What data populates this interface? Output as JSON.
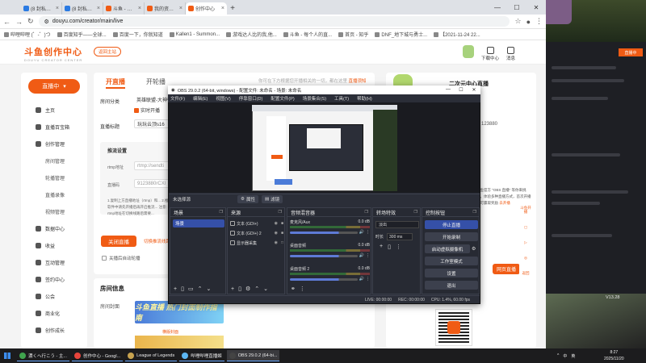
{
  "browser": {
    "tabs": [
      {
        "label": "(8 封私信 / 24 条消息) 斯万 -",
        "color": "#2a7ae2",
        "active": false
      },
      {
        "label": "(8 封私信 / 24 条消息) 如何评",
        "color": "#2a7ae2",
        "active": false
      },
      {
        "label": "斗鱼 - 每个人的直播平台",
        "color": "#f05b14",
        "active": false
      },
      {
        "label": "我的资料 - 个人中心 - 斗鱼",
        "color": "#f05b14",
        "active": false
      },
      {
        "label": "创作中心",
        "color": "#f05b14",
        "active": true
      }
    ],
    "new_tab": "+",
    "url": "douyu.com/creator/main/live",
    "bookmarks": [
      "哔哩哔哩 (゜-゜)つ",
      "百度知乎——全球...",
      "百度一下，你就知道",
      "Kallen1 - Summon...",
      "游戏达人比的我,他...",
      "斗鱼 - 每个人的直...",
      "首页 - 知乎",
      "DNF_地下城与勇士...",
      "【2021-11-24 22..."
    ]
  },
  "douyu": {
    "logo": "斗鱼创作中心",
    "logo_sub": "DOUYU CREATOR CENTER",
    "home_button": "返回主站",
    "download_center": "下载中心",
    "messages": "消息",
    "live_button": "直播中",
    "sidebar": [
      {
        "label": "主页",
        "sub": []
      },
      {
        "label": "直播百宝箱",
        "sub": []
      },
      {
        "label": "创作管理",
        "sub": [
          "房间管理",
          "轮播管理",
          "直播录像",
          "视频管理"
        ]
      },
      {
        "label": "数据中心",
        "sub": []
      },
      {
        "label": "收益",
        "sub": []
      },
      {
        "label": "互动管理",
        "sub": []
      },
      {
        "label": "签约中心",
        "sub": []
      },
      {
        "label": "公会",
        "sub": []
      },
      {
        "label": "商业化",
        "sub": []
      },
      {
        "label": "创作成长",
        "sub": []
      }
    ],
    "tabs": {
      "open": "开直播",
      "mobile": "开轮播"
    },
    "tip": "你可在下方根据您开播相关的一切，都在这里",
    "tip_link": "直播须知",
    "form": {
      "category_label": "房间分类",
      "category_value": "英雄联盟-大神带",
      "checkbox_label": "实时开播",
      "title_label": "直播标题",
      "title_value": "玩玩云顶s16",
      "settings_title": "推流设置",
      "rtmp_label": "rtmp地址",
      "rtmp_value": "rtmp://sendti",
      "code_label": "直播码",
      "code_value": "9123880rCXl",
      "notes": "1.复制上方直播地址（rtmp）和... 2.推流软件中请先开播后再开启推流... 注意：rtmp地址在切换线路后需要...",
      "start_button": "关闭直播",
      "start_link": "切换推流线路",
      "auto_label": "关播后自动轮播"
    },
    "room": {
      "title": "房间信息",
      "cover_label": "房间封面",
      "banner1": "斗鱼直播 热门封面制作指南",
      "banner2_label": "横版封面"
    },
    "right_card": {
      "title": "二次元中心直播",
      "desc": "斗鱼官方 \"OBS 直播\" 等你来挑战，体验多种直播方式，首次开播即可赢取奖励",
      "desc_link": "去开播",
      "code_tail": "123880",
      "web_button": "网页直播"
    },
    "side_float": [
      "斗鱼开播",
      "返回"
    ]
  },
  "obs": {
    "title": "OBS 29.0.2 (64-bit, windows) - 配置文件: 未命名 - 场景: 未命名",
    "menu": [
      "文件(F)",
      "编辑(E)",
      "视图(V)",
      "停靠窗口(D)",
      "配置文件(P)",
      "场景集合(S)",
      "工具(T)",
      "帮助(H)"
    ],
    "no_source": "未选择源",
    "properties": "属性",
    "filters": "滤镜",
    "scenes_title": "场景",
    "scene_item": "场景",
    "sources_title": "来源",
    "sources": [
      {
        "name": "文本 (GDI+)",
        "locked": true
      },
      {
        "name": "文本 (GDI+) 2",
        "locked": true
      },
      {
        "name": "显示器采集",
        "locked": false
      }
    ],
    "mixer_title": "音频混音器",
    "mixer": [
      {
        "name": "麦克风/Aux",
        "db": "0.0 dB",
        "level": 0.72
      },
      {
        "name": "桌面音频",
        "db": "0.0 dB",
        "level": 0.72
      },
      {
        "name": "桌面音频 2",
        "db": "0.0 dB",
        "level": 0.72
      }
    ],
    "transitions_title": "转场特效",
    "transition": "淡出",
    "duration_label": "时长",
    "duration": "300 ms",
    "controls_title": "控制按钮",
    "controls": [
      "停止直播",
      "开始录制",
      "启动虚拟摄像机",
      "工作室模式",
      "设置",
      "退出"
    ],
    "status": {
      "live": "LIVE: 00:00:00",
      "rec": "REC: 00:00:00",
      "cpu": "CPU: 1.4%, 60.00 fps"
    }
  },
  "bg_app": {
    "button": "直播中",
    "version": "V13.28"
  },
  "taskbar": {
    "items": [
      {
        "label": "濃くへ行こう - 主...",
        "color": "#3fa34d",
        "active": false
      },
      {
        "label": "创作中心 - Googl...",
        "color": "#e8453c",
        "active": false
      },
      {
        "label": "League of Legends",
        "color": "#c8a34f",
        "active": false
      },
      {
        "label": "哔哩哔哩直播姬",
        "color": "#5cb6f2",
        "active": false
      },
      {
        "label": "OBS 29.0.2 (64-bi...",
        "color": "#444",
        "active": true
      }
    ],
    "tray": [
      "^",
      "中",
      "英"
    ],
    "time": "8:27",
    "date": "2025/11/20"
  }
}
